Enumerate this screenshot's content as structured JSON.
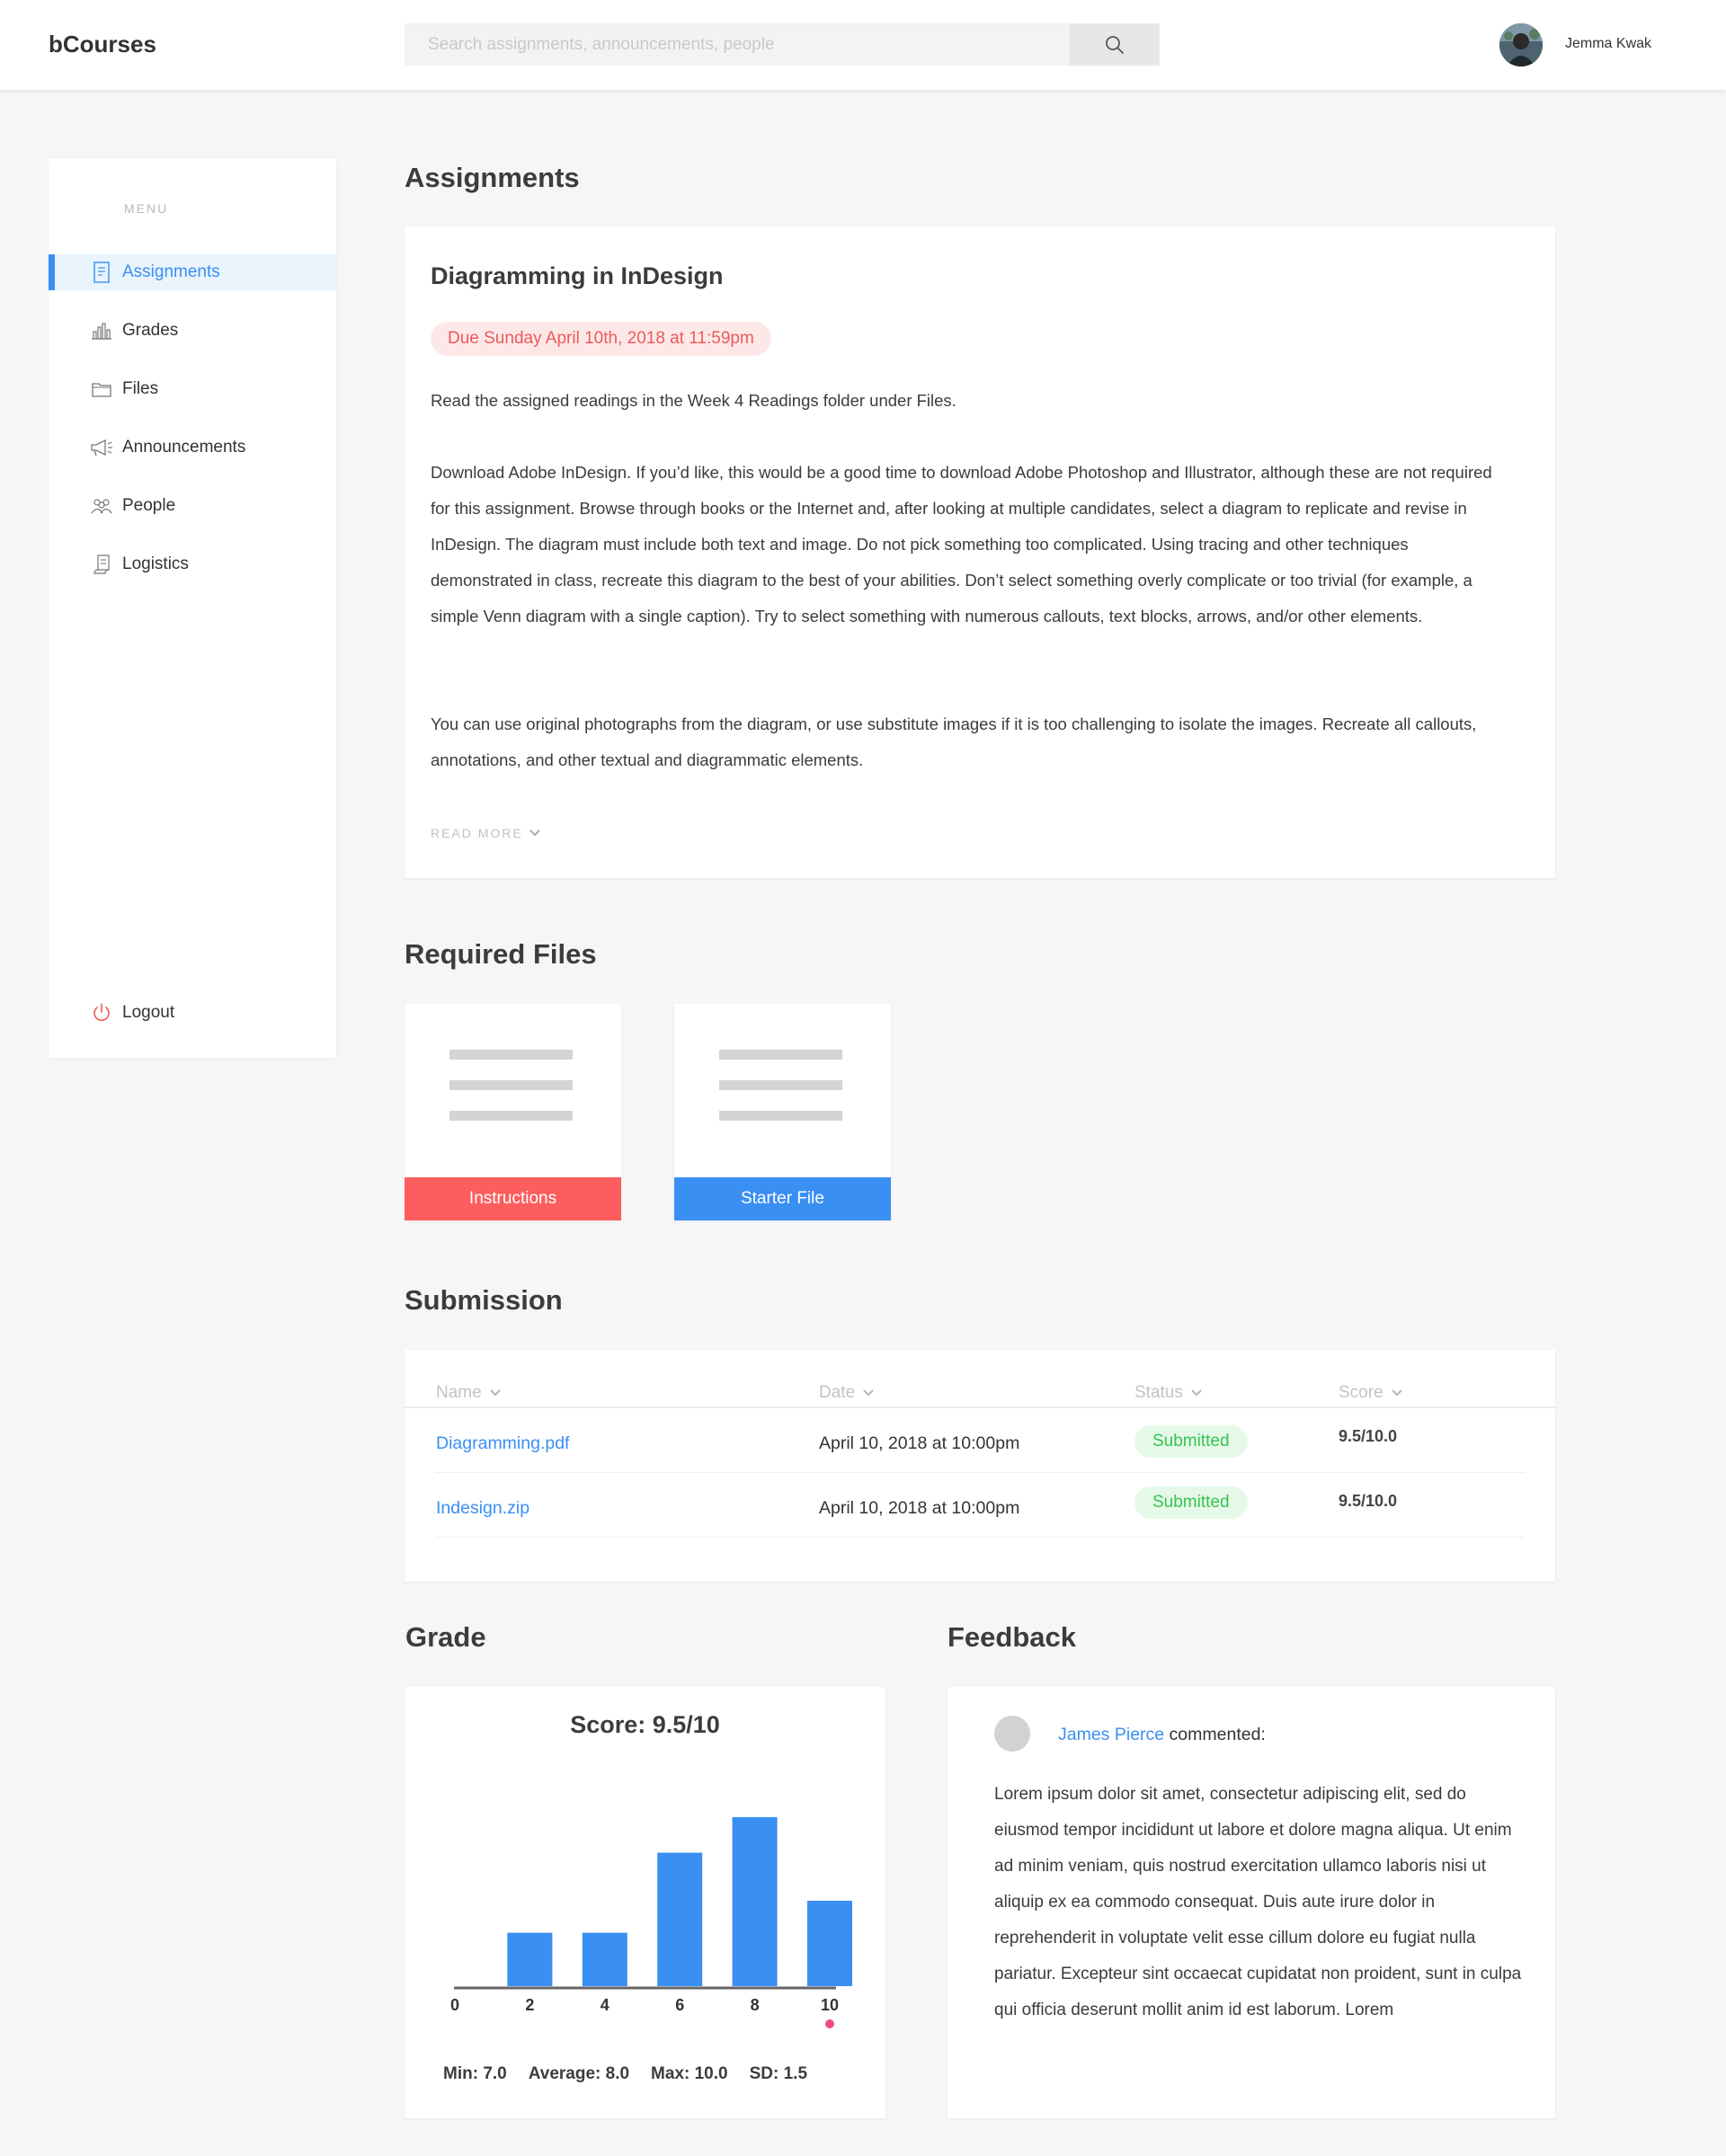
{
  "header": {
    "brand": "bCourses",
    "search_placeholder": "Search assignments, announcements, people",
    "user_name": "Jemma Kwak"
  },
  "sidebar": {
    "menu_title": "MENU",
    "items": [
      {
        "label": "Assignments",
        "icon": "assignment-icon"
      },
      {
        "label": "Grades",
        "icon": "bar-chart-icon"
      },
      {
        "label": "Files",
        "icon": "folder-icon"
      },
      {
        "label": "Announcements",
        "icon": "megaphone-icon"
      },
      {
        "label": "People",
        "icon": "people-icon"
      },
      {
        "label": "Logistics",
        "icon": "scroll-icon"
      }
    ],
    "logout_label": "Logout"
  },
  "assignments": {
    "section_title": "Assignments",
    "title": "Diagramming in InDesign",
    "due": "Due Sunday April 10th, 2018 at 11:59pm",
    "paragraphs": [
      "Read the assigned readings in the Week 4 Readings folder under Files.",
      "Download Adobe InDesign. If you’d like, this would be a good time to download Adobe Photoshop and Illustrator, although these are not required for this assignment. Browse through books or the Internet and, after looking at multiple candidates, select a diagram to replicate and revise in InDesign. The diagram must include both text and image. Do not pick something too complicated. Using tracing and other techniques demonstrated in class, recreate this diagram to the best of your abilities. Don’t select something overly complicate or too trivial (for example, a simple Venn diagram with a single caption). Try to select something with numerous callouts, text blocks, arrows, and/or other elements.",
      "You can use original photographs from the diagram, or use substitute images if it is too challenging to isolate the images. Recreate all callouts, annotations, and other textual and diagrammatic elements."
    ],
    "read_more": "READ MORE"
  },
  "required_files": {
    "section_title": "Required Files",
    "files": [
      {
        "label": "Instructions",
        "color": "#fc5e5e"
      },
      {
        "label": "Starter File",
        "color": "#3a8ff3"
      }
    ]
  },
  "submission": {
    "section_title": "Submission",
    "columns": [
      "Name",
      "Date",
      "Status",
      "Score"
    ],
    "rows": [
      {
        "name": "Diagramming.pdf",
        "date": "April 10, 2018 at 10:00pm",
        "status": "Submitted",
        "score": "9.5/10.0"
      },
      {
        "name": "Indesign.zip",
        "date": "April 10, 2018 at 10:00pm",
        "status": "Submitted",
        "score": "9.5/10.0"
      }
    ]
  },
  "grade": {
    "section_title": "Grade",
    "score_title": "Score: 9.5/10",
    "stats": {
      "min": "Min: 7.0",
      "average": "Average: 8.0",
      "max": "Max: 10.0",
      "sd": "SD: 1.5"
    }
  },
  "chart_data": {
    "type": "bar",
    "categories": [
      "2",
      "4",
      "6",
      "8",
      "10"
    ],
    "values": [
      3,
      3,
      7.5,
      9.5,
      4.8
    ],
    "x_ticks": [
      "0",
      "2",
      "4",
      "6",
      "8",
      "10"
    ],
    "ylim": [
      0,
      10
    ],
    "bar_color": "#3a8ff3",
    "marker": {
      "x": "10",
      "color": "#ec4a8c"
    }
  },
  "feedback": {
    "section_title": "Feedback",
    "commenter": "James Pierce",
    "action": " commented:",
    "text": "Lorem ipsum dolor sit amet, consectetur adipiscing elit, sed do eiusmod tempor incididunt ut labore et dolore magna aliqua. Ut enim ad minim veniam, quis nostrud exercitation ullamco laboris nisi ut aliquip ex ea commodo consequat. Duis aute irure dolor in reprehenderit in voluptate velit esse cillum dolore eu fugiat nulla pariatur. Excepteur sint occaecat cupidatat non proident, sunt in culpa qui officia deserunt mollit anim id est laborum. Lorem"
  }
}
